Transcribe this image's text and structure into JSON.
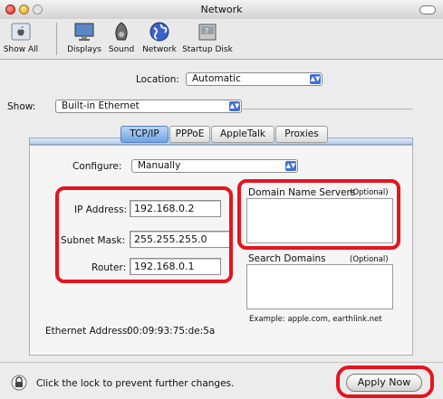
{
  "window": {
    "title": "Network"
  },
  "toolbar": {
    "items": [
      {
        "label": "Show All",
        "icon": "apple-grid-icon"
      },
      {
        "label": "Displays",
        "icon": "display-icon"
      },
      {
        "label": "Sound",
        "icon": "speaker-icon"
      },
      {
        "label": "Network",
        "icon": "globe-icon"
      },
      {
        "label": "Startup Disk",
        "icon": "disk-icon"
      }
    ]
  },
  "location": {
    "label": "Location:",
    "value": "Automatic"
  },
  "show": {
    "label": "Show:",
    "value": "Built-in Ethernet"
  },
  "tabs": [
    {
      "label": "TCP/IP",
      "selected": true
    },
    {
      "label": "PPPoE",
      "selected": false
    },
    {
      "label": "AppleTalk",
      "selected": false
    },
    {
      "label": "Proxies",
      "selected": false
    }
  ],
  "configure": {
    "label": "Configure:",
    "value": "Manually"
  },
  "ip_address": {
    "label": "IP Address:",
    "value": "192.168.0.2"
  },
  "subnet_mask": {
    "label": "Subnet Mask:",
    "value": "255.255.255.0"
  },
  "router": {
    "label": "Router:",
    "value": "192.168.0.1"
  },
  "dns": {
    "label": "Domain Name Servers",
    "optional": "(Optional)"
  },
  "search_domains": {
    "label": "Search Domains",
    "optional": "(Optional)",
    "example": "Example: apple.com, earthlink.net"
  },
  "ethernet": {
    "label": "Ethernet Address:",
    "value": "00:09:93:75:de:5a"
  },
  "footer": {
    "lock_text": "Click the lock to prevent further changes.",
    "apply_label": "Apply Now"
  },
  "colors": {
    "highlight": "#e5141e",
    "tab_selected": "#6da3e6",
    "popup_arrow": "#3d6fd8"
  }
}
